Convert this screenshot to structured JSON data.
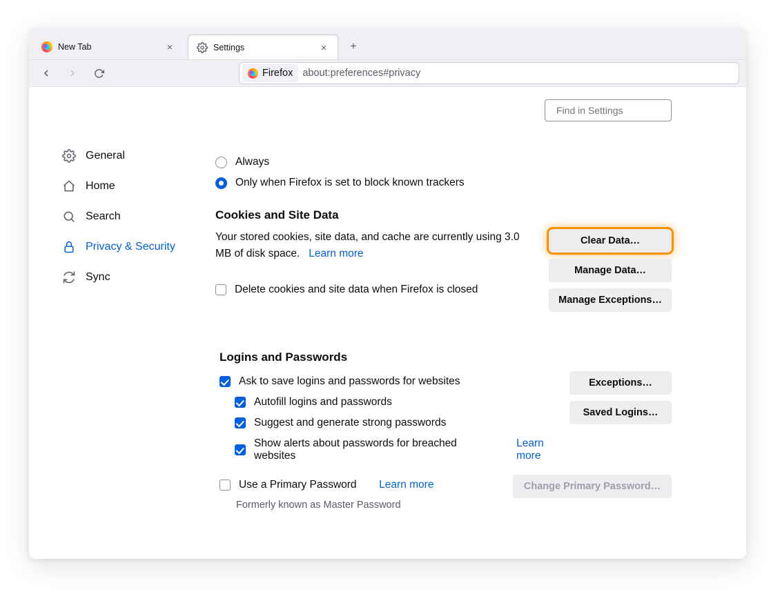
{
  "tabs": {
    "inactive_label": "New Tab",
    "active_label": "Settings"
  },
  "urlbar": {
    "pill_label": "Firefox",
    "url": "about:preferences#privacy"
  },
  "search": {
    "placeholder": "Find in Settings"
  },
  "sidebar": {
    "general": "General",
    "home": "Home",
    "search": "Search",
    "privacy": "Privacy & Security",
    "sync": "Sync"
  },
  "tracker_options": {
    "always": "Always",
    "only_block": "Only when Firefox is set to block known trackers"
  },
  "cookies": {
    "title": "Cookies and Site Data",
    "desc": "Your stored cookies, site data, and cache are currently using 3.0 MB of disk space.",
    "learn_more": "Learn more",
    "delete_on_close": "Delete cookies and site data when Firefox is closed",
    "clear_btn": "Clear Data…",
    "manage_btn": "Manage Data…",
    "exceptions_btn": "Manage Exceptions…"
  },
  "logins": {
    "title": "Logins and Passwords",
    "ask_save": "Ask to save logins and passwords for websites",
    "autofill": "Autofill logins and passwords",
    "suggest": "Suggest and generate strong passwords",
    "breach": "Show alerts about passwords for breached websites",
    "learn_more": "Learn more",
    "use_primary": "Use a Primary Password",
    "learn_more2": "Learn more",
    "change_btn": "Change Primary Password…",
    "exceptions_btn": "Exceptions…",
    "saved_btn": "Saved Logins…",
    "formerly": "Formerly known as Master Password"
  }
}
